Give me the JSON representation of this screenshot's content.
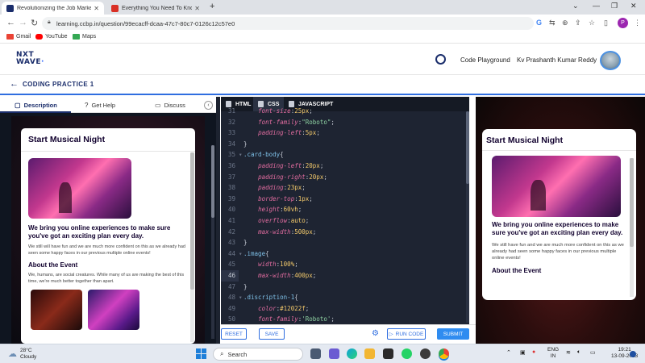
{
  "browser": {
    "tabs": [
      {
        "title": "Revolutionizing the Job Market |",
        "active": true
      },
      {
        "title": "Everything You Need To Know Ab",
        "active": false
      }
    ],
    "url": "learning.ccbp.in/question/99ecacff-dcaa-47c7-80c7-0126c12c57e0",
    "bookmarks": [
      "Gmail",
      "YouTube",
      "Maps"
    ],
    "profile_initial": "P"
  },
  "site": {
    "logo_line1": "NXT",
    "logo_line2": "WAVE",
    "header_links": {
      "playground": "Code Playground",
      "user": "Kv Prashanth Kumar Reddy"
    }
  },
  "practice": {
    "title": "CODING PRACTICE 1"
  },
  "left_tabs": [
    "Description",
    "Get Help",
    "Discuss"
  ],
  "card": {
    "title": "Start Musical Night",
    "heading": "We bring you online experiences to make sure you've got an exciting plan every day.",
    "para1": "We still will have fun and we are much more confident on this as we already had seen some happy faces in our previous multiple online events!",
    "about_title": "About the Event",
    "about_para": "We, humans, are social creatures. While many of us are making the best of this time, we're much better together than apart."
  },
  "right_card": {
    "title": "Start Musical Night",
    "heading": "We bring you online experiences to make sure you've got an exciting plan every day.",
    "para1": "We still have fun and we are much more confident on this as we already had seen some happy faces in our previous multiple online events!",
    "about_title": "About the Event"
  },
  "editor": {
    "tabs": [
      "HTML",
      "CSS",
      "JAVASCRIPT"
    ],
    "lines": [
      {
        "n": "31",
        "fold": "",
        "html": "    <span class='k'>font-size</span>:<span class='v'>25px</span>;"
      },
      {
        "n": "32",
        "fold": "",
        "html": "    <span class='k'>font-family</span>:<span class='s'>\"Roboto\"</span>;"
      },
      {
        "n": "33",
        "fold": "",
        "html": "    <span class='k'>padding-left</span>:<span class='v'>5px</span>;"
      },
      {
        "n": "34",
        "fold": "",
        "html": "}"
      },
      {
        "n": "35",
        "fold": "▾",
        "html": "<span class='sel'>.card-body</span>{"
      },
      {
        "n": "36",
        "fold": "",
        "html": "    <span class='k'>padding-left</span>:<span class='v'>20px</span>;"
      },
      {
        "n": "37",
        "fold": "",
        "html": "    <span class='k'>padding-right</span>:<span class='v'>20px</span>;"
      },
      {
        "n": "38",
        "fold": "",
        "html": "    <span class='k'>padding</span>:<span class='v'>23px</span>;"
      },
      {
        "n": "39",
        "fold": "",
        "html": "    <span class='k'>border-top</span>:<span class='v'>1px</span>;"
      },
      {
        "n": "40",
        "fold": "",
        "html": "    <span class='k'>height</span>:<span class='v'>60vh</span>;"
      },
      {
        "n": "41",
        "fold": "",
        "html": "    <span class='k'>overflow</span>:<span class='v'>auto</span>;"
      },
      {
        "n": "42",
        "fold": "",
        "html": "    <span class='k'>max-width</span>:<span class='v'>500px</span>;"
      },
      {
        "n": "43",
        "fold": "",
        "html": "}"
      },
      {
        "n": "44",
        "fold": "▾",
        "html": "<span class='sel'>.image</span>{"
      },
      {
        "n": "45",
        "fold": "",
        "html": "    <span class='k'>width</span>:<span class='v'>100%</span>;"
      },
      {
        "n": "46",
        "fold": "",
        "html": "    <span class='k'>max-width</span>:<span class='v'>400px</span>;"
      },
      {
        "n": "47",
        "fold": "",
        "html": "}"
      },
      {
        "n": "48",
        "fold": "▾",
        "html": "<span class='sel'>.discription-1</span>{"
      },
      {
        "n": "49",
        "fold": "",
        "html": "    <span class='k'>color</span>:<span class='v'>#12022f</span>;"
      },
      {
        "n": "50",
        "fold": "",
        "html": "    <span class='k'>font-family</span>:<span class='s'>'Roboto'</span>;"
      }
    ],
    "highlight_line": "46"
  },
  "footer": {
    "reset": "RESET",
    "save": "SAVE",
    "run": "RUN CODE",
    "submit": "SUBMIT"
  },
  "taskbar": {
    "weather_temp": "28°C",
    "weather_desc": "Cloudy",
    "search_placeholder": "Search",
    "lang1": "ENG",
    "lang2": "IN",
    "time": "19:21",
    "date": "13-09-2023"
  },
  "colors": {
    "accent": "#2f6ee0",
    "brand_dark": "#1a2d6b",
    "card_text": "#12022f"
  }
}
